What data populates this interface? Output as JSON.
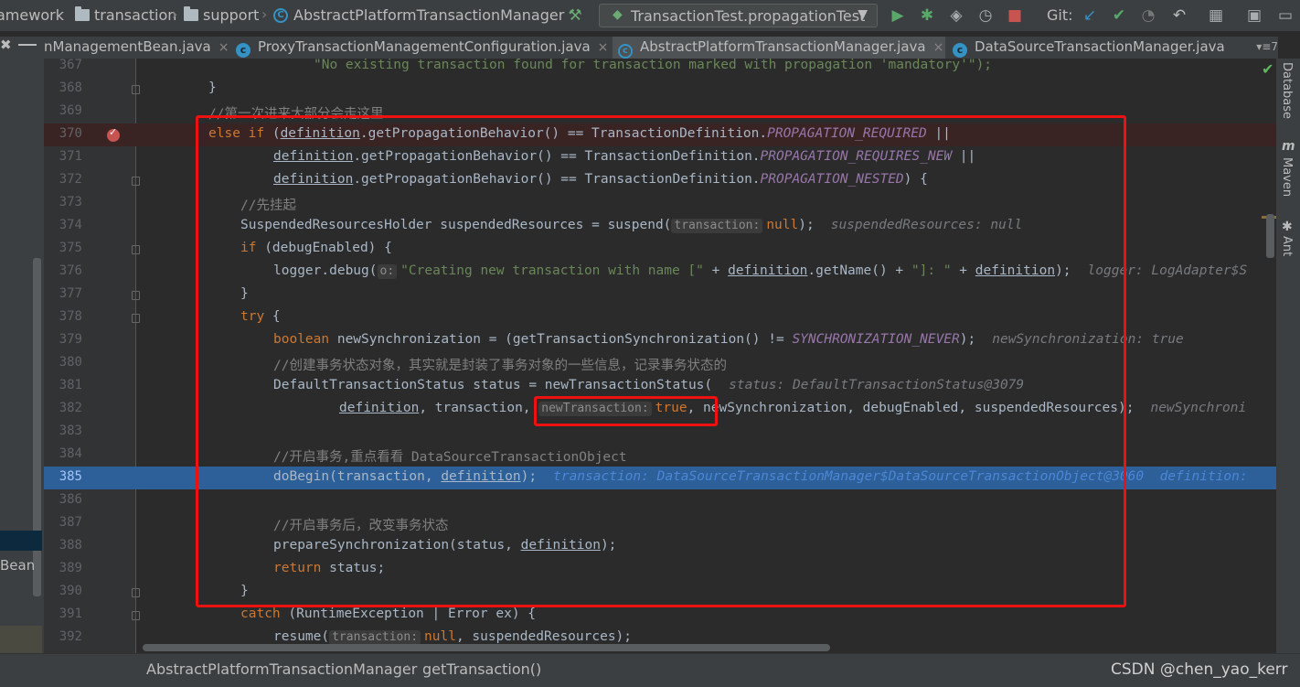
{
  "toolbar": {
    "breadcrumbs": [
      "amework",
      "transaction",
      "support",
      "AbstractPlatformTransactionManager"
    ],
    "run_config": "TransactionTest.propagationTest",
    "git_label": "Git:",
    "icons": [
      "hammer-icon",
      "run-icon",
      "debug-icon",
      "coverage-icon",
      "profile-icon",
      "stop-icon",
      "git-update-icon",
      "git-commit-icon",
      "history-icon",
      "rollback-icon",
      "project-structure-icon",
      "layout-icon"
    ]
  },
  "tabs": [
    {
      "label": "nManagementBean.java",
      "active": false
    },
    {
      "label": "ProxyTransactionManagementConfiguration.java",
      "active": false
    },
    {
      "label": "AbstractPlatformTransactionManager.java",
      "active": true
    },
    {
      "label": "DataSourceTransactionManager.java",
      "active": false
    }
  ],
  "tabs_more": "▾≡7",
  "left_panel": {
    "selected_text": "Bean"
  },
  "right_tools": [
    "Database",
    "Maven",
    "Ant"
  ],
  "editor": {
    "breakpoint_line": 370,
    "execution_line": 385,
    "highlight_box_lines": [
      370,
      390
    ],
    "lines": {
      "367": {
        "a": "\"No existing transaction found for transaction marked with propagation 'mandatory'\");"
      },
      "368": {
        "a": "}"
      },
      "369": {
        "a": "//第一次进来大部分会走这里"
      },
      "370": {
        "a": "else if",
        "b": "definition",
        "c": ".getPropagationBehavior() == TransactionDefinition.",
        "d": "PROPAGATION_REQUIRED",
        "e": " ||"
      },
      "371": {
        "a": "definition",
        "b": ".getPropagationBehavior() == TransactionDefinition.",
        "c": "PROPAGATION_REQUIRES_NEW",
        "d": " ||"
      },
      "372": {
        "a": "definition",
        "b": ".getPropagationBehavior() == TransactionDefinition.",
        "c": "PROPAGATION_NESTED",
        "d": ") {"
      },
      "373": {
        "a": "//先挂起"
      },
      "374": {
        "a": "SuspendedResourcesHolder suspendedResources = suspend(",
        "hint": "transaction:",
        "b": "null",
        "c": ");",
        "inline": "suspendedResources: null"
      },
      "375": {
        "a": "if",
        "b": " (debugEnabled) {"
      },
      "376": {
        "a": "logger.debug(",
        "hint": "o:",
        "str": "\"Creating new transaction with name [\"",
        "b": " + ",
        "c": "definition",
        "d": ".getName() + ",
        "str2": "\"]: \"",
        "e": " + ",
        "f": "definition",
        "g": ");",
        "inline": "logger: LogAdapter$S"
      },
      "377": {
        "a": "}"
      },
      "378": {
        "a": "try",
        "b": " {"
      },
      "379": {
        "a": "boolean",
        "b": " newSynchronization = (getTransactionSynchronization() != ",
        "c": "SYNCHRONIZATION_NEVER",
        "d": ");",
        "inline": "newSynchronization: true"
      },
      "380": {
        "a": "//创建事务状态对象，其实就是封装了事务对象的一些信息，记录事务状态的"
      },
      "381": {
        "a": "DefaultTransactionStatus status = newTransactionStatus(",
        "inline": "status: DefaultTransactionStatus@3079"
      },
      "382": {
        "a": "definition",
        "b": ", transaction, ",
        "hint": "newTransaction:",
        "c": "true",
        "d": ", newSynchronization, debugEnabled, suspendedResources);",
        "inline": "newSynchroni"
      },
      "383": {
        "a": ""
      },
      "384": {
        "a": "//开启事务,重点看看 DataSourceTransactionObject"
      },
      "385": {
        "a": "doBegin(transaction, ",
        "b": "definition",
        "c": ");",
        "inline": "transaction: DataSourceTransactionManager$DataSourceTransactionObject@3060  definition:"
      },
      "386": {
        "a": ""
      },
      "387": {
        "a": "//开启事务后，改变事务状态"
      },
      "388": {
        "a": "prepareSynchronization(status, ",
        "b": "definition",
        "c": ");"
      },
      "389": {
        "a": "return",
        "b": " status;"
      },
      "390": {
        "a": "}"
      },
      "391": {
        "a": "catch",
        "b": " (RuntimeException | Error ex) {"
      },
      "392": {
        "a": "resume(",
        "hint": "transaction:",
        "b": "null",
        "c": ", suspendedResources);"
      }
    }
  },
  "statusbar": {
    "class_name": "AbstractPlatformTransactionManager",
    "separator": "›",
    "method": "getTransaction()",
    "watermark": "CSDN @chen_yao_kerr"
  },
  "colors": {
    "keyword": "#cc7832",
    "comment": "#808080",
    "string": "#6a8759",
    "constant": "#9876aa",
    "execution_line": "#2d6099",
    "breakpoint": "#c75450",
    "annotation_box": "#ee1111"
  }
}
